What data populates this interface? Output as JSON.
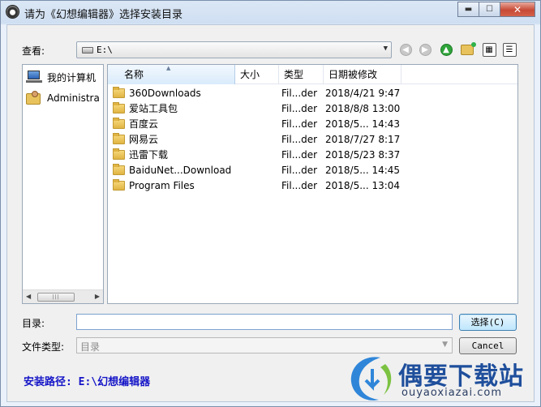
{
  "window": {
    "title": "请为《幻想编辑器》选择安装目录",
    "controls": [
      "minimize",
      "maximize",
      "close"
    ]
  },
  "lookin": {
    "label": "查看:",
    "value": "E:\\"
  },
  "toolbar": {
    "icons": [
      "back-icon",
      "forward-icon",
      "up-folder-icon",
      "new-folder-icon",
      "view-icons-icon",
      "view-details-icon"
    ]
  },
  "places": [
    {
      "label": "我的计算机",
      "icon": "computer-icon"
    },
    {
      "label": "Administra",
      "icon": "user-folder-icon"
    }
  ],
  "columns": {
    "name": "名称",
    "size": "大小",
    "type": "类型",
    "modified": "日期被修改"
  },
  "files": [
    {
      "name": "360Downloads",
      "size": "",
      "type": "Fil...der",
      "modified": "2018/4/21 9:47"
    },
    {
      "name": "爱站工具包",
      "size": "",
      "type": "Fil...der",
      "modified": "2018/8/8 13:00"
    },
    {
      "name": "百度云",
      "size": "",
      "type": "Fil...der",
      "modified": "2018/5... 14:43"
    },
    {
      "name": "网易云",
      "size": "",
      "type": "Fil...der",
      "modified": "2018/7/27 8:17"
    },
    {
      "name": "迅雷下载",
      "size": "",
      "type": "Fil...der",
      "modified": "2018/5/23 8:37"
    },
    {
      "name": "BaiduNet...Download",
      "size": "",
      "type": "Fil...der",
      "modified": "2018/5... 14:45"
    },
    {
      "name": "Program Files",
      "size": "",
      "type": "Fil...der",
      "modified": "2018/5... 13:04"
    }
  ],
  "directory": {
    "label": "目录:",
    "value": ""
  },
  "filetype": {
    "label": "文件类型:",
    "value": "目录"
  },
  "buttons": {
    "choose": "选择(C)",
    "cancel": "Cancel"
  },
  "install_path": "安装路径: E:\\幻想编辑器",
  "watermark": {
    "name": "偶要下载站",
    "url": "ouyaoxiazai.com"
  }
}
